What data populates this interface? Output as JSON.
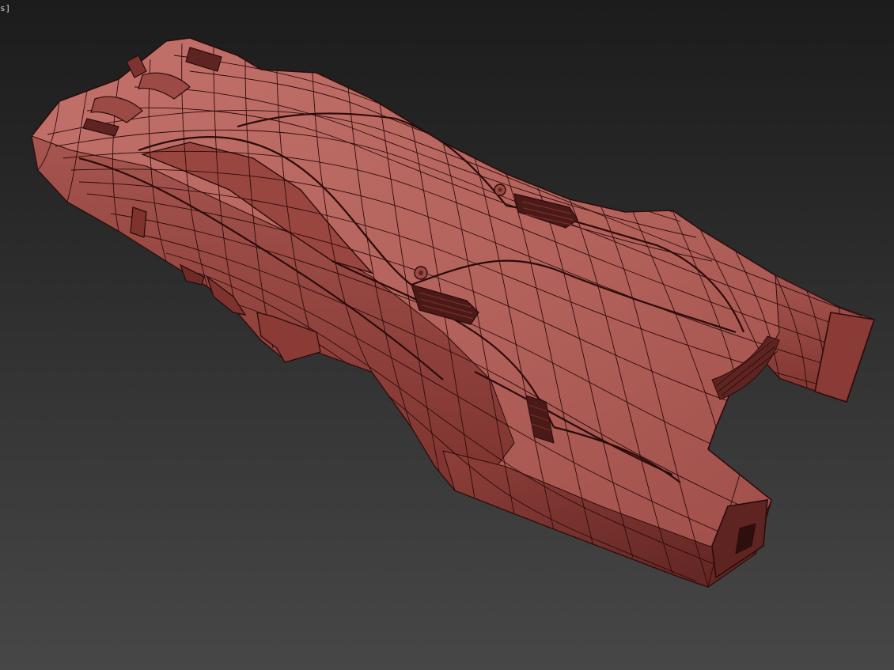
{
  "viewport": {
    "label_text": "s]"
  },
  "model": {
    "display_mode": "shaded-wireframe",
    "colors": {
      "surface_light": "#b86a64",
      "surface_mid": "#a85852",
      "surface_dark": "#8a3b36",
      "shadow": "#5e2421",
      "wire": "#2a0c0a",
      "background_top": "#1c1c1c",
      "background_bottom": "#474747"
    }
  }
}
